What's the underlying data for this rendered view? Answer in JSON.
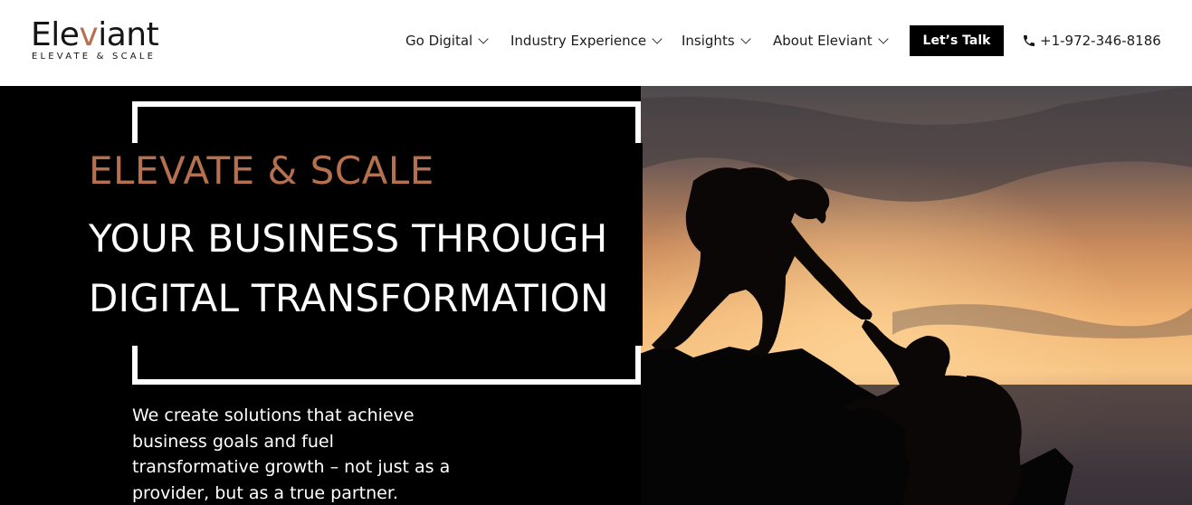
{
  "header": {
    "logo": {
      "word_start": "Ele",
      "word_accent": "v",
      "word_end": "iant",
      "tagline": "ELEVATE & SCALE"
    },
    "nav": [
      {
        "label": "Go Digital"
      },
      {
        "label": "Industry Experience"
      },
      {
        "label": "Insights"
      },
      {
        "label": "About Eleviant"
      }
    ],
    "cta_label": "Let’s Talk",
    "phone": "+1-972-346-8186"
  },
  "hero": {
    "headline_accent": "ELEVATE & SCALE",
    "headline_line1": "YOUR BUSINESS THROUGH",
    "headline_line2": "DIGITAL TRANSFORMATION",
    "intro": "We create solutions that achieve business goals and fuel transformative growth – not just as a provider, but as a true partner."
  },
  "colors": {
    "accent": "#b5714f",
    "background": "#000000",
    "header_bg": "#ffffff"
  },
  "icons": [
    "chevron-down-icon",
    "phone-icon"
  ]
}
